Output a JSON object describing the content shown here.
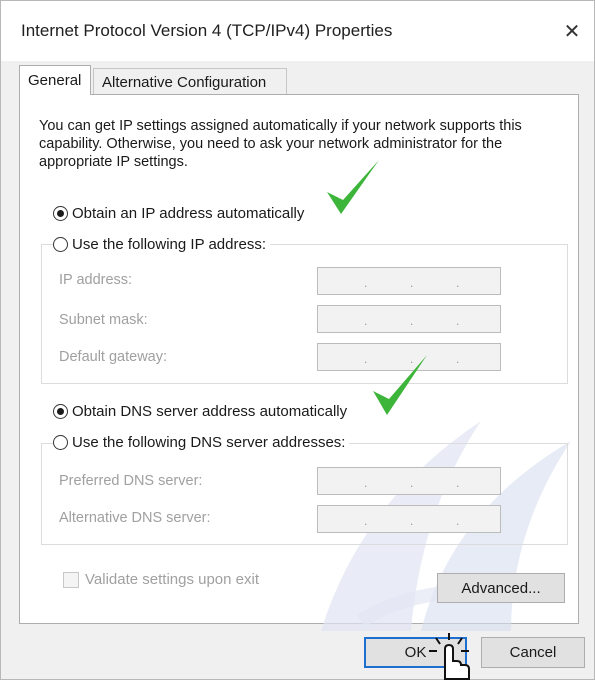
{
  "window": {
    "title": "Internet Protocol Version 4 (TCP/IPv4) Properties",
    "close_glyph": "✕"
  },
  "tabs": [
    {
      "label": "General",
      "active": true
    },
    {
      "label": "Alternative Configuration",
      "active": false
    }
  ],
  "intro_text": "You can get IP settings assigned automatically if your network supports this capability. Otherwise, you need to ask your network administrator for the appropriate IP settings.",
  "ip_section": {
    "auto_label": "Obtain an IP address automatically",
    "auto_selected": true,
    "manual_label": "Use the following IP address:",
    "manual_selected": false,
    "fields": [
      {
        "label": "IP address:",
        "value": " .   .   . "
      },
      {
        "label": "Subnet mask:",
        "value": " .   .   . "
      },
      {
        "label": "Default gateway:",
        "value": " .   .   . "
      }
    ]
  },
  "dns_section": {
    "auto_label": "Obtain DNS server address automatically",
    "auto_selected": true,
    "manual_label": "Use the following DNS server addresses:",
    "manual_selected": false,
    "fields": [
      {
        "label": "Preferred DNS server:",
        "value": " .   .   . "
      },
      {
        "label": "Alternative DNS server:",
        "value": " .   .   . "
      }
    ]
  },
  "validate_label": "Validate settings upon exit",
  "validate_checked": false,
  "buttons": {
    "advanced": "Advanced...",
    "ok": "OK",
    "cancel": "Cancel"
  },
  "colors": {
    "checkmark": "#3db53a",
    "ok_border": "#1e6fd0",
    "watermark": "#cfd6ea"
  },
  "icons": {
    "close": "close-icon",
    "checkmark": "checkmark-icon",
    "cursor": "hand-pointer-icon"
  }
}
